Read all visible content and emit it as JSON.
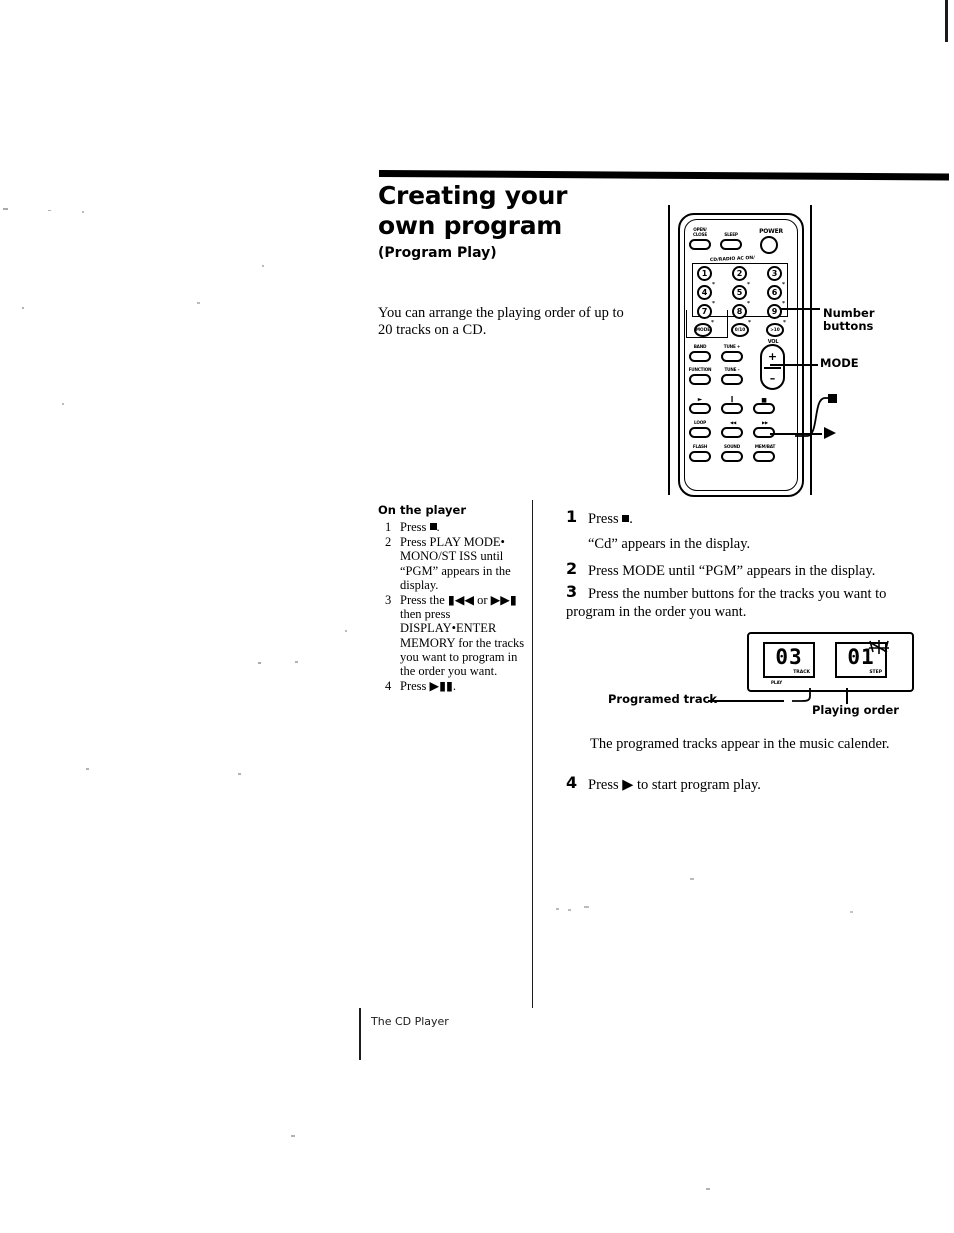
{
  "document": {
    "title": "Creating your own program",
    "title_line1": "Creating your",
    "title_line2": "own program",
    "subtitle": "(Program Play)",
    "intro": "You can arrange the playing order of up to 20 tracks on a CD.",
    "footer": "The CD Player"
  },
  "remote": {
    "top_row": [
      {
        "label": "OPEN/\nCLOSE",
        "name": "open-close"
      },
      {
        "label": "SLEEP",
        "name": "sleep"
      },
      {
        "label": "POWER",
        "name": "power"
      }
    ],
    "section_label": "CD/RADIO  AC ON/",
    "number_keys": [
      {
        "label": "1",
        "asterisk": false
      },
      {
        "label": "2",
        "asterisk": false
      },
      {
        "label": "3",
        "asterisk": false
      },
      {
        "label": "4",
        "asterisk": true
      },
      {
        "label": "5",
        "asterisk": true
      },
      {
        "label": "6",
        "asterisk": true
      },
      {
        "label": "7",
        "asterisk": true
      },
      {
        "label": "8",
        "asterisk": true
      },
      {
        "label": "9",
        "asterisk": true
      }
    ],
    "mode_row": [
      {
        "label": "MODE",
        "asterisk": true
      },
      {
        "label": "0/10",
        "asterisk": true
      },
      {
        "label": ">10",
        "asterisk": true
      }
    ],
    "vol_label": "VOL",
    "function_rows": [
      {
        "left": "BAND",
        "mid": "TUNE +"
      },
      {
        "left": "FUNCTION",
        "mid": "TUNE –"
      }
    ],
    "volume": {
      "plus": "+",
      "minus": "–"
    },
    "transport_row": [
      {
        "label": "►",
        "name": "play"
      },
      {
        "label": "Ⅱ",
        "name": "pause"
      },
      {
        "label": "▬",
        "name": "stop"
      }
    ],
    "skip_row": [
      {
        "label": "LOOP",
        "name": "loop"
      },
      {
        "label": "◄◄",
        "name": "rewind"
      },
      {
        "label": "►►",
        "name": "forward"
      }
    ],
    "bottom_row": [
      {
        "label": "FLASH",
        "name": "flash"
      },
      {
        "label": "SOUND",
        "name": "sound"
      },
      {
        "label": "MEM/BAT",
        "name": "mem-bat"
      }
    ],
    "callouts": {
      "number_buttons": "Number\nbuttons",
      "mode": "MODE",
      "stop_symbol": "■",
      "play_symbol": "►"
    }
  },
  "on_the_player": {
    "heading": "On the player",
    "steps": [
      {
        "num": "1",
        "text": "Press ■."
      },
      {
        "num": "2",
        "text": "Press PLAY MODE• MONO/ST ISS until “PGM” appears in the display."
      },
      {
        "num": "3",
        "text": "Press the ◄◄ or ►►| then press DISPLAY•ENTER MEMORY for the tracks you want to program in the order you want."
      },
      {
        "num": "4",
        "text": "Press ►||."
      }
    ]
  },
  "main_steps": [
    {
      "num": "1",
      "text": "Press ■.",
      "note": "“Cd” appears in the display."
    },
    {
      "num": "2",
      "text": "Press MODE until “PGM” appears in the display.",
      "note": ""
    },
    {
      "num": "3",
      "text": "Press the number buttons for the tracks you want to program in the order you want.",
      "note": ""
    },
    {
      "num": "4",
      "text": "Press ► to start program play.",
      "note": ""
    }
  ],
  "display_figure": {
    "track_value": "03",
    "track_label": "TRACK",
    "play_label": "PLAY",
    "step_value": "01",
    "step_label": "STEP",
    "callout_left": "Programed track",
    "callout_right": "Playing order"
  },
  "calendar_note": "The programed tracks appear in the music calender.",
  "colors": {
    "ink": "#000000",
    "paper": "#ffffff",
    "faded_ink": "#1c1c1c"
  }
}
